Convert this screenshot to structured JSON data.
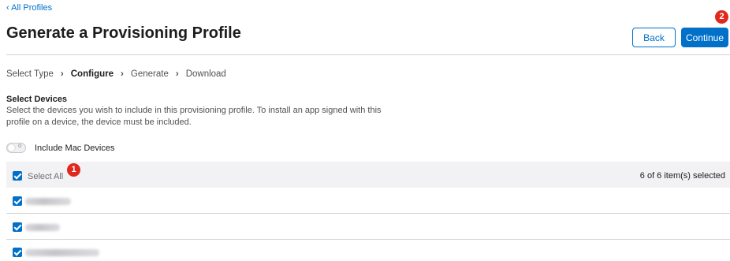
{
  "nav": {
    "back_link": "‹ All Profiles"
  },
  "header": {
    "title": "Generate a Provisioning Profile"
  },
  "actions": {
    "back_label": "Back",
    "continue_label": "Continue"
  },
  "annotations": {
    "select_all_badge": "1",
    "continue_badge": "2",
    "badge_color": "#e0281d"
  },
  "steps": {
    "items": [
      "Select Type",
      "Configure",
      "Generate",
      "Download"
    ],
    "active": "Configure",
    "separator": "›"
  },
  "devices_section": {
    "heading": "Select Devices",
    "description": "Select the devices you wish to include in this provisioning profile. To install an app signed with this profile on a device, the device must be included."
  },
  "toggle": {
    "label": "Include Mac Devices",
    "checked": false
  },
  "select_all": {
    "label": "Select All",
    "checked": true,
    "count_text": "6 of 6 item(s) selected"
  },
  "devices": [
    {
      "name": "iPhone",
      "checked": true
    },
    {
      "name": "iPad",
      "checked": true
    },
    {
      "name": "iPhone",
      "checked": true
    }
  ],
  "colors": {
    "accent": "#0070c9",
    "text": "#1d1d1f",
    "muted": "#515154",
    "row_bg": "#f2f2f4"
  }
}
